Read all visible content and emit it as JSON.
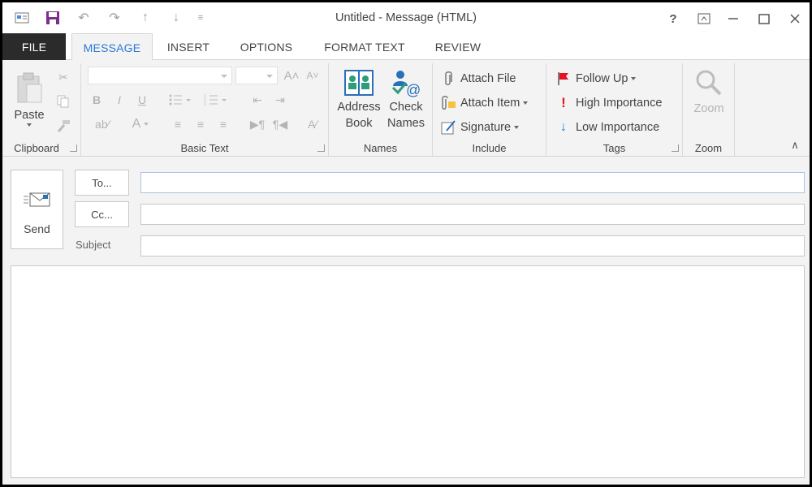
{
  "window": {
    "title": "Untitled - Message (HTML)",
    "help_label": "?"
  },
  "quick_access": {
    "icons": [
      "envelope-icon",
      "save-icon",
      "undo-icon",
      "redo-icon",
      "up-arrow-icon",
      "down-arrow-icon",
      "customize-icon"
    ]
  },
  "tabs": [
    {
      "label": "FILE"
    },
    {
      "label": "MESSAGE",
      "active": true
    },
    {
      "label": "INSERT"
    },
    {
      "label": "OPTIONS"
    },
    {
      "label": "FORMAT TEXT"
    },
    {
      "label": "REVIEW"
    }
  ],
  "ribbon": {
    "clipboard": {
      "label": "Clipboard",
      "paste_label": "Paste"
    },
    "basic_text": {
      "label": "Basic Text",
      "font_name": "",
      "font_size": "",
      "bold": "B",
      "italic": "I",
      "underline": "U",
      "font_color": "A"
    },
    "names": {
      "label": "Names",
      "address_book_line1": "Address",
      "address_book_line2": "Book",
      "check_names_line1": "Check",
      "check_names_line2": "Names"
    },
    "include": {
      "label": "Include",
      "attach_file": "Attach File",
      "attach_item": "Attach Item",
      "signature": "Signature"
    },
    "tags": {
      "label": "Tags",
      "follow_up": "Follow Up",
      "high_importance": "High Importance",
      "low_importance": "Low Importance"
    },
    "zoom": {
      "label": "Zoom",
      "zoom_label": "Zoom"
    }
  },
  "compose": {
    "send_label": "Send",
    "to_label": "To...",
    "cc_label": "Cc...",
    "subject_label": "Subject",
    "to_value": "",
    "cc_value": "",
    "subject_value": "",
    "body": ""
  },
  "colors": {
    "accent": "#2b78d4",
    "file_tab": "#2b2b2b",
    "high_importance": "#e81123",
    "low_importance": "#2b78d4",
    "follow_up_flag": "#e81123"
  }
}
